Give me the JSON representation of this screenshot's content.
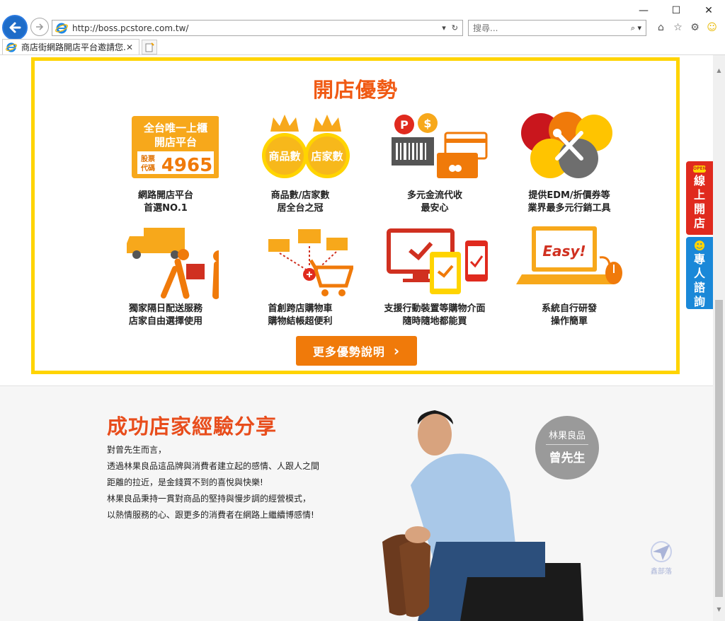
{
  "browser": {
    "url": "http://boss.pcstore.com.tw/",
    "search_placeholder": "搜尋...",
    "tab_title": "商店街網路開店平台邀請您...",
    "tab_close": "✕",
    "minimize": "—",
    "maximize": "☐",
    "close": "✕"
  },
  "advantages": {
    "title": "開店優勢",
    "badge1": {
      "line1": "全台唯一上櫃",
      "line2": "開店平台",
      "stock_line1": "股票",
      "stock_line2": "代碼",
      "code": "4965"
    },
    "crown_left": "商品數",
    "crown_right": "店家數",
    "easy_text": "Easy!",
    "features": [
      {
        "line1": "網路開店平台",
        "line2": "首選NO.1"
      },
      {
        "line1": "商品數/店家數",
        "line2": "居全台之冠"
      },
      {
        "line1": "多元金流代收",
        "line2": "最安心"
      },
      {
        "line1": "提供EDM/折價券等",
        "line2": "業界最多元行銷工具"
      },
      {
        "line1": "獨家隔日配送服務",
        "line2": "店家自由選擇使用"
      },
      {
        "line1": "首創跨店購物車",
        "line2": "購物結帳超便利"
      },
      {
        "line1": "支援行動裝置等購物介面",
        "line2": "隨時隨地都能買"
      },
      {
        "line1": "系統自行研發",
        "line2": "操作簡單"
      }
    ],
    "more_button": "更多優勢說明",
    "more_arrow": "›"
  },
  "side_tabs": {
    "open_badge": "OPEN",
    "open": [
      "線",
      "上",
      "開",
      "店"
    ],
    "ask": [
      "專",
      "人",
      "諮",
      "詢"
    ]
  },
  "story": {
    "title": "成功店家經驗分享",
    "lines": [
      "對曾先生而言，",
      "透過林果良品這品牌與消費者建立起的感情、人跟人之間",
      "距離的拉近，是金錢買不到的喜悅與快樂!",
      "林果良品秉持一貫對商品的堅持與慢步調的經營模式，",
      "以熱情服務的心、跟更多的消費者在網路上繼續博感情!"
    ],
    "shop_name": "林果良品",
    "person_name": "曾先生",
    "watermark": "鑫部落"
  },
  "colors": {
    "orange": "#f07a0a",
    "title_red": "#f05a14",
    "yellow": "#ffd400",
    "red": "#e02a1e",
    "blue": "#1a88d8"
  }
}
